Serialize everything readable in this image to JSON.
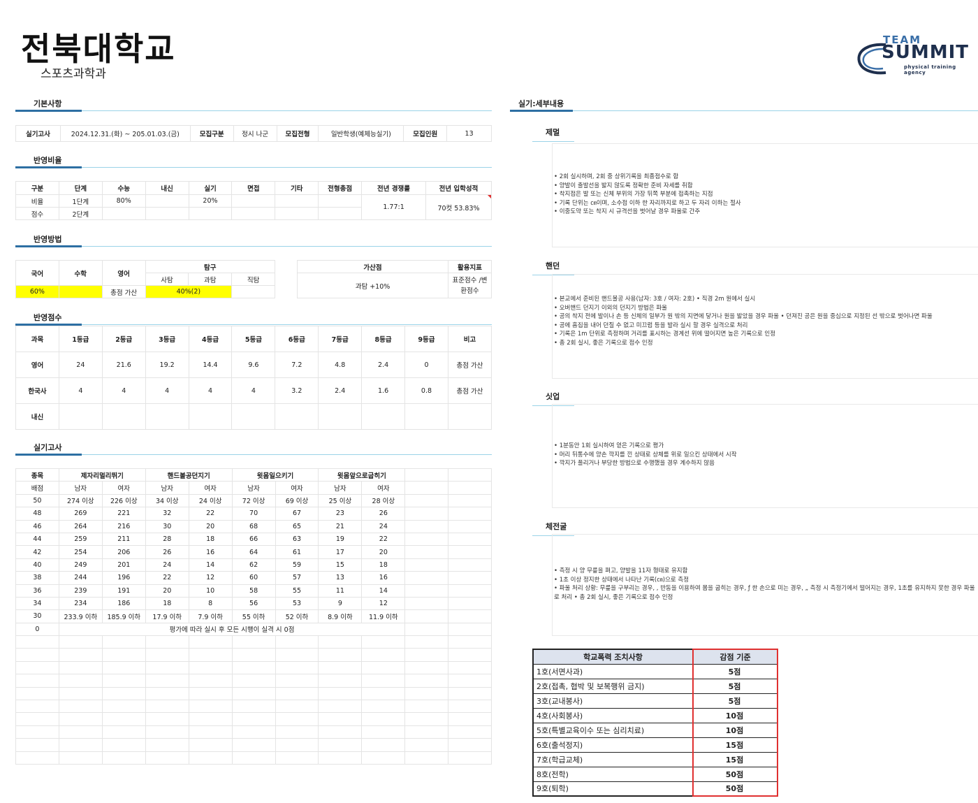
{
  "header": {
    "title": "전북대학교",
    "subtitle": "스포츠과학과",
    "logo": {
      "team": "TEAM",
      "brand": "SUMMIT",
      "tagline": "physical training agency"
    }
  },
  "basic": {
    "section": "기본사항",
    "exam_label": "실기고사",
    "exam_date": "2024.12.31.(화) ~ 205.01.03.(금)",
    "recruit_type_label": "모집구분",
    "recruit_type": "정시 나군",
    "track_label": "모집전형",
    "track": "일반학생(예체능실기)",
    "quota_label": "모집인원",
    "quota": "13"
  },
  "ratio": {
    "section": "반영비율",
    "headers": [
      "구분",
      "단계",
      "수능",
      "내신",
      "실기",
      "면접",
      "기타",
      "전형총점",
      "전년 경쟁률",
      "전년 입학성적"
    ],
    "row1": [
      "비율",
      "1단계",
      "80%",
      "",
      "20%",
      "",
      "",
      ""
    ],
    "row2": [
      "점수",
      "2단계",
      "",
      "",
      "",
      "",
      "",
      ""
    ],
    "competition": "1.77:1",
    "admission": "70컷 53.83%"
  },
  "method": {
    "section": "반영방법",
    "korean": "국어",
    "math": "수학",
    "english": "영어",
    "inquiry": "탐구",
    "inq_sub": [
      "사탐",
      "과탐",
      "직탐"
    ],
    "korean_val": "60%",
    "math_val": "",
    "english_val": "총점 가산",
    "inq_val": "40%(2)",
    "jik_val": "",
    "bonus_label": "가산점",
    "bonus": "과탐 +10%",
    "index_label": "활용지표",
    "index": "표준점수 /변환점수"
  },
  "scores": {
    "section": "반영점수",
    "headers": [
      "과목",
      "1등급",
      "2등급",
      "3등급",
      "4등급",
      "5등급",
      "6등급",
      "7등급",
      "8등급",
      "9등급",
      "비고"
    ],
    "rows": [
      [
        "영어",
        "24",
        "21.6",
        "19.2",
        "14.4",
        "9.6",
        "7.2",
        "4.8",
        "2.4",
        "0",
        "총점 가산"
      ],
      [
        "한국사",
        "4",
        "4",
        "4",
        "4",
        "4",
        "3.2",
        "2.4",
        "1.6",
        "0.8",
        "총점 가산"
      ],
      [
        "내신",
        "",
        "",
        "",
        "",
        "",
        "",
        "",
        "",
        "",
        ""
      ]
    ]
  },
  "practical": {
    "section": "실기고사",
    "events": [
      "종목",
      "제자리멀리뛰기",
      "핸드볼공던지기",
      "윗몸일으키기",
      "윗몸앞으로굽히기"
    ],
    "gender_row": [
      "배점",
      "남자",
      "여자",
      "남자",
      "여자",
      "남자",
      "여자",
      "남자",
      "여자"
    ],
    "rows": [
      [
        "50",
        "274 이상",
        "226 이상",
        "34 이상",
        "24 이상",
        "72 이상",
        "69 이상",
        "25 이상",
        "28 이상"
      ],
      [
        "48",
        "269",
        "221",
        "32",
        "22",
        "70",
        "67",
        "23",
        "26"
      ],
      [
        "46",
        "264",
        "216",
        "30",
        "20",
        "68",
        "65",
        "21",
        "24"
      ],
      [
        "44",
        "259",
        "211",
        "28",
        "18",
        "66",
        "63",
        "19",
        "22"
      ],
      [
        "42",
        "254",
        "206",
        "26",
        "16",
        "64",
        "61",
        "17",
        "20"
      ],
      [
        "40",
        "249",
        "201",
        "24",
        "14",
        "62",
        "59",
        "15",
        "18"
      ],
      [
        "38",
        "244",
        "196",
        "22",
        "12",
        "60",
        "57",
        "13",
        "16"
      ],
      [
        "36",
        "239",
        "191",
        "20",
        "10",
        "58",
        "55",
        "11",
        "14"
      ],
      [
        "34",
        "234",
        "186",
        "18",
        "8",
        "56",
        "53",
        "9",
        "12"
      ],
      [
        "30",
        "233.9 이하",
        "185.9 이하",
        "17.9 이하",
        "7.9 이하",
        "55 이하",
        "52 이하",
        "8.9 이하",
        "11.9 이하"
      ]
    ],
    "zero_score": "0",
    "zero_note": "평가에 따라 실시 후 모든 시행이 실격 시 0점"
  },
  "details": {
    "section": "실기:세부내용",
    "items": [
      {
        "title": "제멀",
        "lines": [
          "• 2회 실시하며, 2회 중 상위기록을 최종점수로 함",
          " • 양발이 출발선을 밟지 않도록 정확한 준비 자세를 취함",
          " • 착지점은 발 또는 신체 부위의 가장 뒤쪽 부분에 접촉하는 지점",
          " • 기록 단위는 ㎝이며, 소수점 이하 한 자리까지로 하고 두 자리 이하는 절사",
          " • 이중도약 또는 착지 시 규격선을 벗어날 경우 파울로 간주"
        ]
      },
      {
        "title": "핸던",
        "lines": [
          "• 본교에서 준비된 핸드볼공 사용(남자: 3호 / 여자: 2호) • 직경 2m 원에서 실시",
          " • 오버핸드 던지기 이외의 던지기 방법은 파울",
          " • 공의 착지 전에 발이나 손 등 신체의 일부가 원 밖의 지면에 닿거나 원을 밟았을 경우 파울 • 던져진 공은 원을 중심으로 지정된 선 밖으로 벗어나면 파울",
          " • 공에 흠집을 내어 던질 수 없고 미끄럼 등을 발라 실시 할 경우 실격으로 처리",
          " • 기록은 1m 단위로 측정하며 거리를 표시하는 경계선 위에 떨어지면 높은 기록으로 인정",
          " • 총 2회 실시, 좋은 기록으로 점수 인정"
        ]
      },
      {
        "title": "싯업",
        "lines": [
          "• 1분동안 1회 실시하여 얻은 기록으로 평가",
          " • 머리 뒤통수에 양손 깍지를 낀 상태로 상체를 위로 일으킨 상태에서 시작",
          " • 깍지가 풀리거나 부당한 방법으로 수행했을 경우 계수하지 않음"
        ]
      },
      {
        "title": "체전굴",
        "lines": [
          "• 측정 시 양 무릎을 펴고, 양발을 11자 형태로 유지함",
          " • 1초 이상 정지한 상태에서 나타난 기록(㎝)으로 측정",
          " • 파울 처리 상황: 무릎을 구부리는 경우, , 반동을 이용하여 몸을 굽히는 경우, ƒ 한 손으로 미는 경우, „ 측정 시 측정기에서 떨어지는 경우, 1초를 유지하지 못한 경우 파울로 처리 • 총 2회 실시, 좋은 기록으로 점수 인정"
        ]
      }
    ]
  },
  "violence": {
    "headers": [
      "학교폭력 조치사항",
      "감점 기준"
    ],
    "rows": [
      [
        "1호(서면사과)",
        "5점"
      ],
      [
        "2호(접촉, 협박 및 보복행위 금지)",
        "5점"
      ],
      [
        "3호(교내봉사)",
        "5점"
      ],
      [
        "4호(사회봉사)",
        "10점"
      ],
      [
        "5호(특별교육이수 또는 심리치료)",
        "10점"
      ],
      [
        "6호(출석정지)",
        "15점"
      ],
      [
        "7호(학급교체)",
        "15점"
      ],
      [
        "8호(전학)",
        "50점"
      ],
      [
        "9호(퇴학)",
        "50점"
      ]
    ]
  },
  "colors": {
    "accent_line": "#9ad3e8",
    "tab_underline": "#2d6fa3",
    "highlight": "#ffff00",
    "red_border": "#e03030"
  }
}
